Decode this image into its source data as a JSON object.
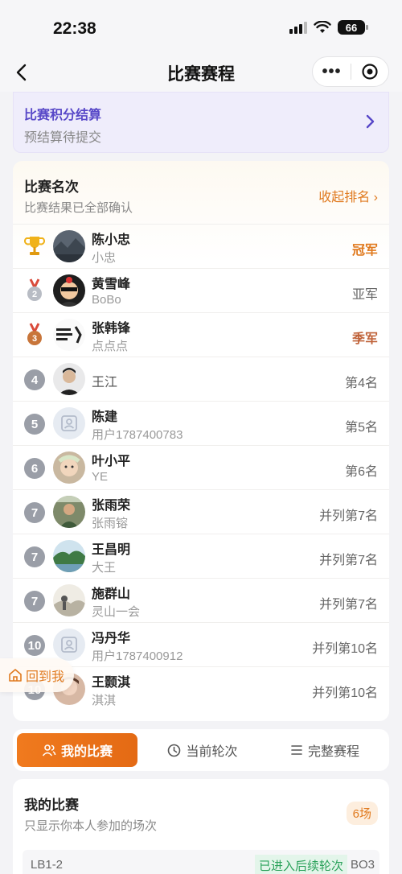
{
  "status_bar": {
    "time": "22:38",
    "battery": "66"
  },
  "nav": {
    "title": "比赛赛程",
    "more_label": "•••"
  },
  "settlement": {
    "title": "比赛积分结算",
    "subtitle": "预结算待提交"
  },
  "ranking": {
    "title": "比赛名次",
    "subtitle": "比赛结果已全部确认",
    "collapse_label": "收起排名 ›",
    "rows": [
      {
        "rank": "1",
        "name": "陈小忠",
        "nickname": "小忠",
        "label": "冠军"
      },
      {
        "rank": "2",
        "name": "黄雪峰",
        "nickname": "BoBo",
        "label": "亚军"
      },
      {
        "rank": "3",
        "name": "张韩锋",
        "nickname": "点点点",
        "label": "季军"
      },
      {
        "rank": "4",
        "name": "王江",
        "nickname": "",
        "label": "第4名"
      },
      {
        "rank": "5",
        "name": "陈建",
        "nickname": "用户1787400783",
        "label": "第5名"
      },
      {
        "rank": "6",
        "name": "叶小平",
        "nickname": "YE",
        "label": "第6名"
      },
      {
        "rank": "7",
        "name": "张雨荣",
        "nickname": "张雨镕",
        "label": "并列第7名"
      },
      {
        "rank": "7",
        "name": "王昌明",
        "nickname": "大王",
        "label": "并列第7名"
      },
      {
        "rank": "7",
        "name": "施群山",
        "nickname": "灵山一会",
        "label": "并列第7名"
      },
      {
        "rank": "10",
        "name": "冯丹华",
        "nickname": "用户1787400912",
        "label": "并列第10名"
      },
      {
        "rank": "10",
        "name": "王颢淇",
        "nickname": "淇淇",
        "label": "并列第10名"
      }
    ]
  },
  "back_to_me": "回到我",
  "tabs": {
    "my_matches": "我的比赛",
    "current_round": "当前轮次",
    "full_schedule": "完整赛程"
  },
  "my_matches": {
    "title": "我的比赛",
    "subtitle": "只显示你本人参加的场次",
    "count": "6场",
    "first_match": {
      "id": "LB1-2",
      "status": "已进入后续轮次",
      "format": "BO3"
    }
  },
  "colors": {
    "accent": "#e07a1f",
    "purple": "#5848c8",
    "green": "#2aa15a"
  }
}
